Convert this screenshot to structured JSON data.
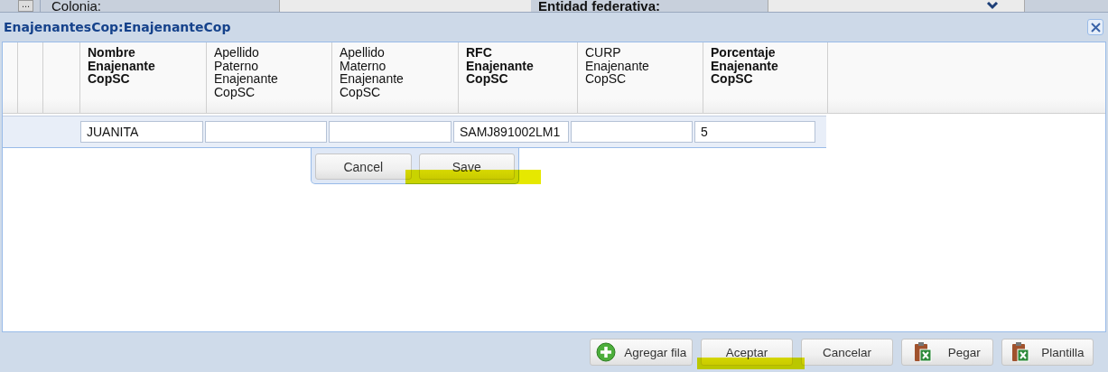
{
  "background_form": {
    "button": "...",
    "fields": [
      {
        "label": "Colonia:",
        "kind": "text"
      },
      {
        "label": "Entidad federativa:",
        "kind": "dropdown"
      }
    ]
  },
  "dialog": {
    "title": "EnajenantesCop:EnajenanteCop"
  },
  "table": {
    "columns": [
      {
        "label": "Nombre Enajenante CopSC",
        "required": true
      },
      {
        "label": "Apellido Paterno Enajenante CopSC",
        "required": false
      },
      {
        "label": "Apellido Materno Enajenante CopSC",
        "required": false
      },
      {
        "label": "RFC Enajenante CopSC",
        "required": true
      },
      {
        "label": "CURP Enajenante CopSC",
        "required": false
      },
      {
        "label": "Porcentaje Enajenante CopSC",
        "required": true
      }
    ],
    "edit_row": {
      "cells": [
        {
          "value": "JUANITA"
        },
        {},
        {},
        {
          "value": "SAMJ891002LM1"
        },
        {},
        {
          "value": "5"
        }
      ]
    }
  },
  "row_editor_buttons": [
    "Cancel",
    "Save"
  ],
  "footer_buttons": [
    {
      "label": "Agregar fila",
      "kind": "add"
    },
    {
      "label": "Aceptar",
      "kind": "plain"
    },
    {
      "label": "Cancelar",
      "kind": "plain"
    },
    {
      "label": "Pegar",
      "kind": "sheet"
    },
    {
      "label": "Plantilla",
      "kind": "sheet"
    }
  ]
}
